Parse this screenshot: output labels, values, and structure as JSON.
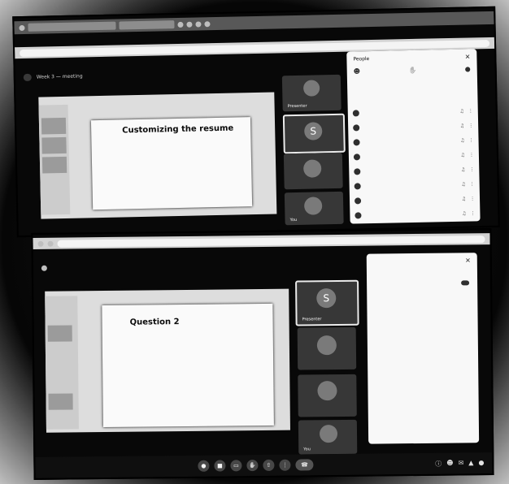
{
  "top": {
    "tab_label": "",
    "meet_title": "Week 3 — meeting",
    "pill": "",
    "slide": {
      "title": "Customizing the resume",
      "bullets": [
        "",
        "",
        "",
        "",
        "",
        "",
        ""
      ],
      "logo": ""
    },
    "tiles": [
      {
        "name": "Presenter",
        "avatar": ""
      },
      {
        "name": "",
        "avatar": "S"
      },
      {
        "name": "",
        "avatar": ""
      },
      {
        "name": "You",
        "avatar": ""
      }
    ],
    "people_panel": {
      "title": "People",
      "actions": [
        "",
        "",
        ""
      ],
      "section": "",
      "participants": [
        "",
        "",
        "",
        "",
        "",
        "",
        "",
        ""
      ]
    }
  },
  "bottom": {
    "meet_title": "",
    "slide": {
      "title": "Question 2",
      "lines": [
        "",
        "",
        "",
        "",
        "",
        "",
        "",
        "",
        "",
        ""
      ],
      "logo": ""
    },
    "tiles": [
      {
        "name": "Presenter",
        "avatar": "S"
      },
      {
        "name": "",
        "avatar": ""
      },
      {
        "name": "",
        "avatar": ""
      },
      {
        "name": "You",
        "avatar": ""
      }
    ],
    "qa_panel": {
      "title": "",
      "lines": [
        "",
        "",
        "",
        "",
        "",
        "",
        "",
        ""
      ]
    },
    "control_bar": {
      "time": "",
      "controls": [
        "mic-icon",
        "camera-icon",
        "captions-icon",
        "raise-hand-icon",
        "present-icon",
        "more-icon",
        "end-call-icon"
      ]
    }
  }
}
